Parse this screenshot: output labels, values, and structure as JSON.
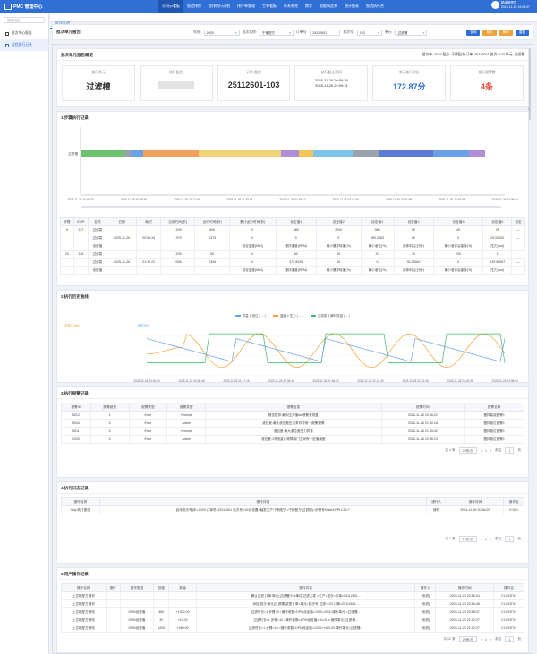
{
  "app": {
    "title": "PMC 管理中心"
  },
  "nav": [
    "公司示看板",
    "智造排程",
    "智排执行计划",
    "排产单管理",
    "工单看板",
    "体系补充",
    "数学",
    "智能制造系",
    "统计报表",
    "智造执行合"
  ],
  "user": {
    "name": "超级管理员",
    "time": "2025-11-26 15:04:07"
  },
  "sidebar": {
    "search_placeholder": "搜索功能",
    "items": [
      "批次中心报告",
      "过程执行记录"
    ]
  },
  "tab": "批次证明",
  "filter": {
    "title": "批次单元报告",
    "fields": [
      {
        "label": "年份:",
        "value": "2025"
      },
      {
        "label": "批次名称:",
        "value": "干燥配方"
      },
      {
        "label": "订单号:",
        "value": "25112601"
      },
      {
        "label": "批次号:",
        "value": "103"
      },
      {
        "label": "单元:",
        "value": "过滤槽"
      }
    ],
    "buttons": [
      {
        "label": "查询",
        "color": "#2f6fd6"
      },
      {
        "label": "导出",
        "color": "#f0a23a"
      },
      {
        "label": "刷新",
        "color": "#f0a23a"
      },
      {
        "label": "重置",
        "color": "#2f6fd6"
      }
    ]
  },
  "summary": {
    "title": "批次单元报告概览",
    "right": "批次单: 2025 配方: 干燥配方 订单: 25112601 批次: 103 单元: 过滤槽",
    "cards": [
      {
        "label": "执行单元",
        "value": "过滤槽",
        "color": "#333"
      },
      {
        "label": "执行配方",
        "value": "",
        "color": "#333"
      },
      {
        "label": "订单-批次",
        "value": "25112601-103",
        "color": "#333"
      },
      {
        "label": "执行起止时间",
        "value": "2025-11-26 20:56:29\n2025-11-26 22:09:21",
        "color": "#333"
      },
      {
        "label": "单元执行时长",
        "value": "172.87分",
        "color": "#2f6fd6"
      },
      {
        "label": "执行报警数",
        "value": "4条",
        "color": "#e64b3c"
      }
    ]
  },
  "section1": {
    "title": "1.步骤执行记录",
    "ticks": [
      "2025-11-26 20:40:20",
      "2025-11-26 20:58:48",
      "2025-11-26 21:17:16",
      "2025-11-26 21:35:44",
      "2025-11-26 21:54:12",
      "2025-11-26 22:12:40",
      "2025-11-26 22:31:08",
      "2025-11-26 22:49:36",
      "2025-11-26 23:08:04"
    ],
    "ylabel": "过滤槽",
    "headers": [
      "步骤",
      "ID/IP",
      "名称",
      "日期",
      "耗时",
      "当前时间(秒)",
      "运行时间(秒)",
      "累计运行时间(秒)",
      "设定值1",
      "设定值2",
      "设定值3",
      "设定值4",
      "设定值5",
      "设定值6",
      "设定"
    ],
    "rows": [
      [
        "9",
        "227",
        "过滤泵",
        "",
        "",
        "1209",
        "600",
        "0",
        "480",
        "2000",
        "380",
        "60",
        "45",
        "25",
        "—"
      ],
      [
        "",
        "",
        "过滤泵",
        "2025-11-26",
        "20:56:34",
        "1379",
        "1379",
        "0",
        "0",
        "0",
        "380.2083",
        "60",
        "0",
        "25.00000",
        "—"
      ],
      [
        "",
        "",
        "设定值",
        "",
        "",
        "",
        "",
        "设定温度(MIN)",
        "搅拌速度(RPM)",
        "最小搅拌转速(%)",
        "最小液位(%)",
        "液体料位(分钟)",
        "最小液体后保持(%)",
        "压力(bar)",
        ""
      ],
      [
        "10",
        "228",
        "过滤泵",
        "",
        "",
        "1209",
        "60",
        "0",
        "60",
        "30",
        "20",
        "10",
        "240",
        "1"
      ],
      [
        "",
        "",
        "过滤泵",
        "2025-11-26",
        "21:37:22",
        "2306",
        "2306",
        "0",
        "379.8028",
        "60",
        "0",
        "35.26562",
        "0",
        "239.96687",
        "—"
      ],
      [
        "",
        "",
        "设定值",
        "",
        "",
        "",
        "",
        "设定温度(MIN)",
        "搅拌速度(RPM)",
        "最小搅拌转速(%)",
        "最小液位(%)",
        "液体料位(分钟)",
        "最小液体后保持(%)",
        "压力(bar)",
        ""
      ]
    ]
  },
  "section2": {
    "title": "2.执行历史曲线",
    "legend": [
      "质量 1 液位 ( ... )",
      "溫度 2 压力 ( ... )",
      "过滤泵 3 瞬时流量 ( ... )"
    ],
    "axis_left_a": "流量(L/min)",
    "axis_left_b": "液位(%)",
    "ticks": [
      "2025-11-26 20:40:20",
      "2025-11-26 20:58:48",
      "2025-11-26 21:17:16",
      "2025-11-26 21:35:44",
      "2025-11-26 21:54:12",
      "2025-11-26 22:12:40",
      "2025-11-26 22:31:08",
      "2025-11-26 22:49:36",
      "2025-11-26 23:08:04"
    ]
  },
  "section3": {
    "title": "3.执行报警记录",
    "headers": [
      "报警ID",
      "报警级别",
      "报警类型",
      "报警类型",
      "报警信息",
      "报警时间",
      "报警名称"
    ],
    "rows": [
      [
        "5012",
        "1",
        "Error",
        "Normal",
        "报告搅拌:最大压力值fail报警未恢复",
        "2025-11-26 20:56:21",
        "搅拌高液报警1"
      ],
      [
        "5044",
        "3",
        "Error",
        "Alarm",
        "液位差:最大液位差压力条件异常一报警报警",
        "2025-11-26 21:40:18",
        "搅拌液位报警1"
      ],
      [
        "5011",
        "3",
        "Error",
        "Normal",
        "液位差:最大液位差压力异常",
        "2025-11-26 21:55:42",
        "搅拌液位报警1"
      ],
      [
        "1030",
        "3",
        "Error",
        "Alarm",
        "液位差:1号流量计故障阀门之间有一定值偏差",
        "2025-11-26 22:46:10",
        "搅拌液位报警1"
      ]
    ],
    "pager": {
      "total": "共 4 条",
      "size": "20条/页",
      "page": "1",
      "goto": "前往",
      "unit": "页"
    }
  },
  "section4": {
    "title": "4.执行日志记录",
    "headers": [
      "操作名称",
      "操作详情",
      "操作人",
      "操作时间",
      "操作名"
    ],
    "rows": [
      [
        "Step执行报告",
        "启动批次号(年=2025 订单号=25112601 批次号=103) 设置=触发生产\\下粉配方=干燥配方(过滤槽)=步骤号Hakft4:RPLC02:?",
        "操作",
        "2025-11-26 20:56:29",
        "IC001"
      ]
    ],
    "pager": {
      "total": "共 1 条",
      "size": "20条/页",
      "page": "1",
      "goto": "前往",
      "unit": "页"
    }
  },
  "section5": {
    "title": "5.用户操作记录",
    "headers": [
      "操作名称",
      "操作",
      "操作类型",
      "旧值",
      "新值",
      "操作内容",
      "操作人",
      "操作时间",
      "操作名"
    ],
    "rows": [
      [
        "上位机配方操作",
        "",
        "",
        "",
        "",
        "确认过滤 订单:单元(过滤槽)Tu4单位 过滤主泵 =生产=批次=订单=25112601...",
        "[系统]",
        "2025-11-26 20:56:24",
        "CLIENT01"
      ],
      [
        "上位机配方操作",
        "",
        "",
        "",
        "",
        "添加 批次:单元(过滤槽)变更订单=单元=批次号 过滤=103 订单=25112601...",
        "[系统]",
        "2025-11-26 20:56:48",
        "CLIENT01"
      ],
      [
        "上位机配方修改",
        "",
        "DPM设定值",
        "480",
        "+1300.00",
        "过滤时长=1 步骤=9 =操作参数=DPM设定值=1300=20.3=操作单元 =过滤槽...",
        "[系统]",
        "2025-11-26 20:58:07",
        "CLIENT01"
      ],
      [
        "上位机配方修改",
        "",
        "DPM设定值",
        "30",
        "+10.00",
        "过滤时长=1 步骤=10 =操作参数=DPM设定值=30=8.3=操作单元=过滤槽...",
        "[系统]",
        "2025-11-26 21:02:27",
        "CLIENT01"
      ],
      [
        "上位机配方修改",
        "",
        "DPM设定值",
        "1200",
        "+480.00",
        "过滤时长=1 步骤=10 =操作参数=DPM设定值=1200=+480.00 操作单元=过滤槽...",
        "[系统]",
        "2025-11-26 21:02:27",
        "CLIENT01"
      ]
    ],
    "pager": {
      "total": "共 12 条",
      "size": "20条/页",
      "page": "1",
      "goto": "前往",
      "unit": "页"
    }
  }
}
